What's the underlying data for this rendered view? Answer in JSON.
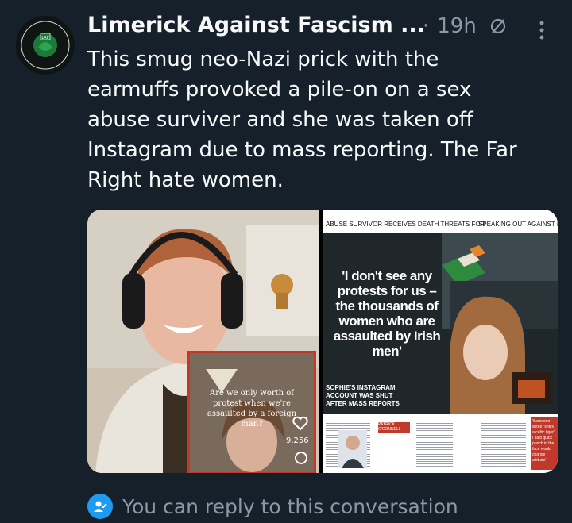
{
  "tweet": {
    "author_name": "Limerick Against Fascism ...",
    "separator": "·",
    "time": "19h",
    "text": "This smug neo-Nazi prick with the earmuffs provoked a pile-on on a sex abuse surviver and she was taken off Instagram due to mass reporting. The Far Right hate women.",
    "avatar_label": "LAF"
  },
  "media": {
    "left_caption": "Are we only worth of protest when we're assaulted by a foreign man?",
    "left_likes": "9,256",
    "newspaper_kicker_left": "ABUSE SURVIVOR RECEIVES DEATH THREATS FOR",
    "newspaper_kicker_right": "SPEAKING OUT AGAINST R",
    "newspaper_quote": "'I don't see any protests for us – the thousands of women who are assaulted by Irish men'",
    "newspaper_subhead": "SOPHIE'S INSTAGRAM ACCOUNT WAS SHUT AFTER MASS REPORTS",
    "newspaper_byline": "PATRICK O'CONNELL",
    "newspaper_pullquote": "'Someone wrote \"she's a celtic tiger\" I said quick punch in the face would change attitude'"
  },
  "reply": {
    "text": "You can reply to this conversation"
  },
  "colors": {
    "background": "#15202b",
    "text": "#f7f9f9",
    "muted": "#8b98a5",
    "accent": "#1d9bf0"
  },
  "icons": {
    "grok": "slash-circle-icon",
    "more": "more-vertical-icon",
    "reply_limit": "person-check-icon"
  }
}
